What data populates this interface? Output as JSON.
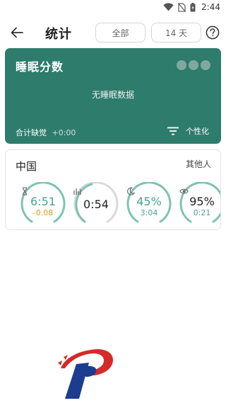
{
  "status_bar": {
    "time": "2:44"
  },
  "app_bar": {
    "title": "统计",
    "range_all": "全部",
    "range_14": "14 天"
  },
  "sleep_card": {
    "title": "睡眠分数",
    "empty_text": "无睡眠数据",
    "deficit_label": "合计缺觉",
    "deficit_value": "+0:00",
    "personalize_label": "个性化",
    "color": "#2e7c6b"
  },
  "region_card": {
    "title": "中国",
    "other_label": "其他人",
    "gauges": [
      {
        "icon": "hourglass-icon",
        "value": "6:51",
        "sub": "-0.08",
        "value_color": "#4aa392",
        "sub_color": "#e09a1a",
        "ring_color": "#7ec2b4"
      },
      {
        "icon": "sleep-chart-icon",
        "value": "0:54",
        "sub": "",
        "value_color": "#222222",
        "sub_color": "#222222",
        "ring_color": "#7ec2b4"
      },
      {
        "icon": "moon-icon",
        "value": "45%",
        "sub": "3:04",
        "value_color": "#4aa392",
        "sub_color": "#4aa392",
        "ring_color": "#7ec2b4"
      },
      {
        "icon": "eye-icon",
        "value": "95%",
        "sub": "0:21",
        "value_color": "#222222",
        "sub_color": "#4aa392",
        "ring_color": "#7ec2b4"
      }
    ]
  },
  "colors": {
    "accent": "#2e7c6b",
    "teal_text": "#4aa392",
    "orange": "#e09a1a"
  }
}
